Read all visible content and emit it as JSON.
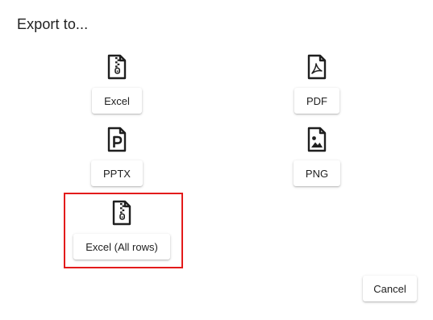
{
  "dialog": {
    "title": "Export to...",
    "cancel_label": "Cancel"
  },
  "options": [
    {
      "label": "Excel",
      "icon": "file-zip-icon"
    },
    {
      "label": "PDF",
      "icon": "file-pdf-icon"
    },
    {
      "label": "PPTX",
      "icon": "file-pptx-icon"
    },
    {
      "label": "PNG",
      "icon": "file-image-icon"
    },
    {
      "label": "Excel (All rows)",
      "icon": "file-zip-icon"
    }
  ],
  "highlight_color": "#e31b1b"
}
